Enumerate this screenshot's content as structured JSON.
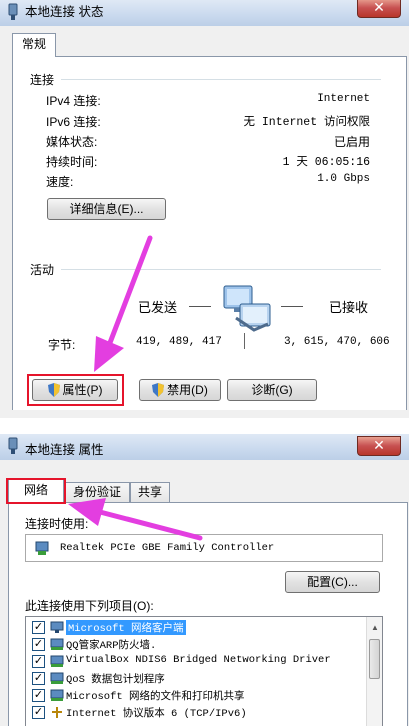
{
  "status_dialog": {
    "title": "本地连接 状态",
    "close_glyph": "✕",
    "tab_general": "常规",
    "connection": {
      "heading": "连接",
      "rows": [
        {
          "label": "IPv4 连接:",
          "value": "Internet"
        },
        {
          "label": "IPv6 连接:",
          "value": "无 Internet 访问权限"
        },
        {
          "label": "媒体状态:",
          "value": "已启用"
        },
        {
          "label": "持续时间:",
          "value": "1 天 06:05:16"
        },
        {
          "label": "速度:",
          "value": "1.0 Gbps"
        }
      ],
      "details_button": "详细信息(E)..."
    },
    "activity": {
      "heading": "活动",
      "sent_label": "已发送",
      "received_label": "已接收",
      "bytes_label": "字节:",
      "bytes_sent": "419, 489, 417",
      "bytes_received": "3, 615, 470, 606"
    },
    "buttons": {
      "properties": "属性(P)",
      "disable": "禁用(D)",
      "diagnose": "诊断(G)"
    }
  },
  "properties_dialog": {
    "title": "本地连接 属性",
    "close_glyph": "✕",
    "tabs": [
      "网络",
      "身份验证",
      "共享"
    ],
    "connect_using_label": "连接时使用:",
    "adapter_name": "Realtek PCIe GBE Family Controller",
    "configure_button": "配置(C)...",
    "items_label": "此连接使用下列项目(O):",
    "items": [
      {
        "text": "Microsoft 网络客户端",
        "checked": true,
        "selected": true,
        "icon": "network-client-icon"
      },
      {
        "text": "QQ管家ARP防火墙.",
        "checked": true,
        "selected": false,
        "icon": "network-service-icon"
      },
      {
        "text": "VirtualBox NDIS6 Bridged Networking Driver",
        "checked": true,
        "selected": false,
        "icon": "network-service-icon"
      },
      {
        "text": "QoS 数据包计划程序",
        "checked": true,
        "selected": false,
        "icon": "network-service-icon"
      },
      {
        "text": "Microsoft 网络的文件和打印机共享",
        "checked": true,
        "selected": false,
        "icon": "network-service-icon"
      },
      {
        "text": "Internet 协议版本 6 (TCP/IPv6)",
        "checked": true,
        "selected": false,
        "icon": "protocol-icon"
      }
    ]
  },
  "colors": {
    "annotation_red": "#e5142b",
    "annotation_arrow": "#e33ee0",
    "selection_blue": "#3399ff"
  }
}
